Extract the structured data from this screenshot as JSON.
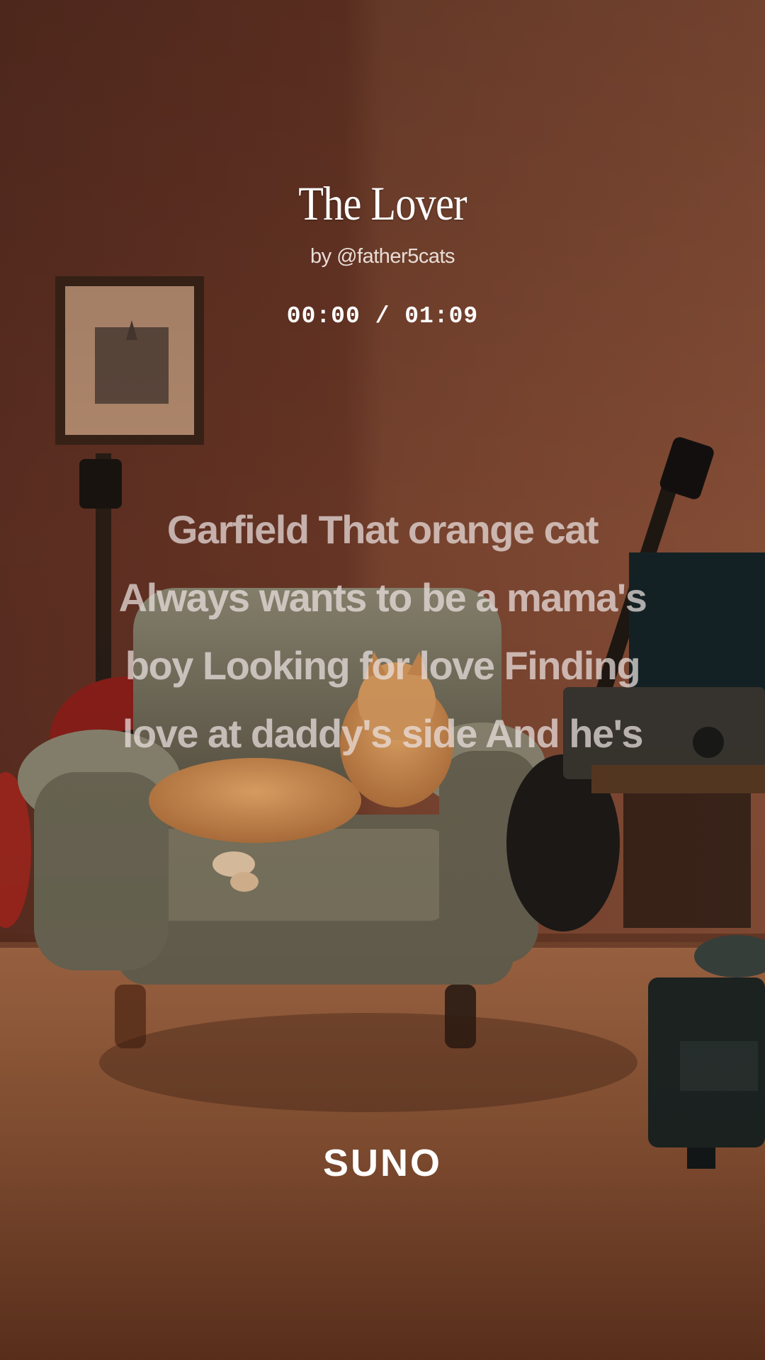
{
  "song": {
    "title": "The Lover",
    "author": "by @father5cats",
    "time_current": "00:00",
    "time_separator": "/",
    "time_total": "01:09",
    "time_display": "00:00 / 01:09"
  },
  "lyrics": {
    "lines": [
      "Garfield That orange cat",
      "Always wants to be a mama's",
      "boy Looking for love Finding",
      "love at daddy's side And he's"
    ]
  },
  "branding": {
    "logo_text": "SUNO"
  },
  "colors": {
    "wall": "#7a4330",
    "floor": "#9a5a3a",
    "armchair": "#7c7660",
    "cat": "#d89458",
    "text_primary": "#ffffff",
    "lyric_text": "#ece2e0"
  },
  "background": {
    "scene_icons": [
      "framed-picture-icon",
      "guitar-icon",
      "armchair-icon",
      "cat-icon",
      "record-player-icon",
      "radio-icon"
    ]
  }
}
